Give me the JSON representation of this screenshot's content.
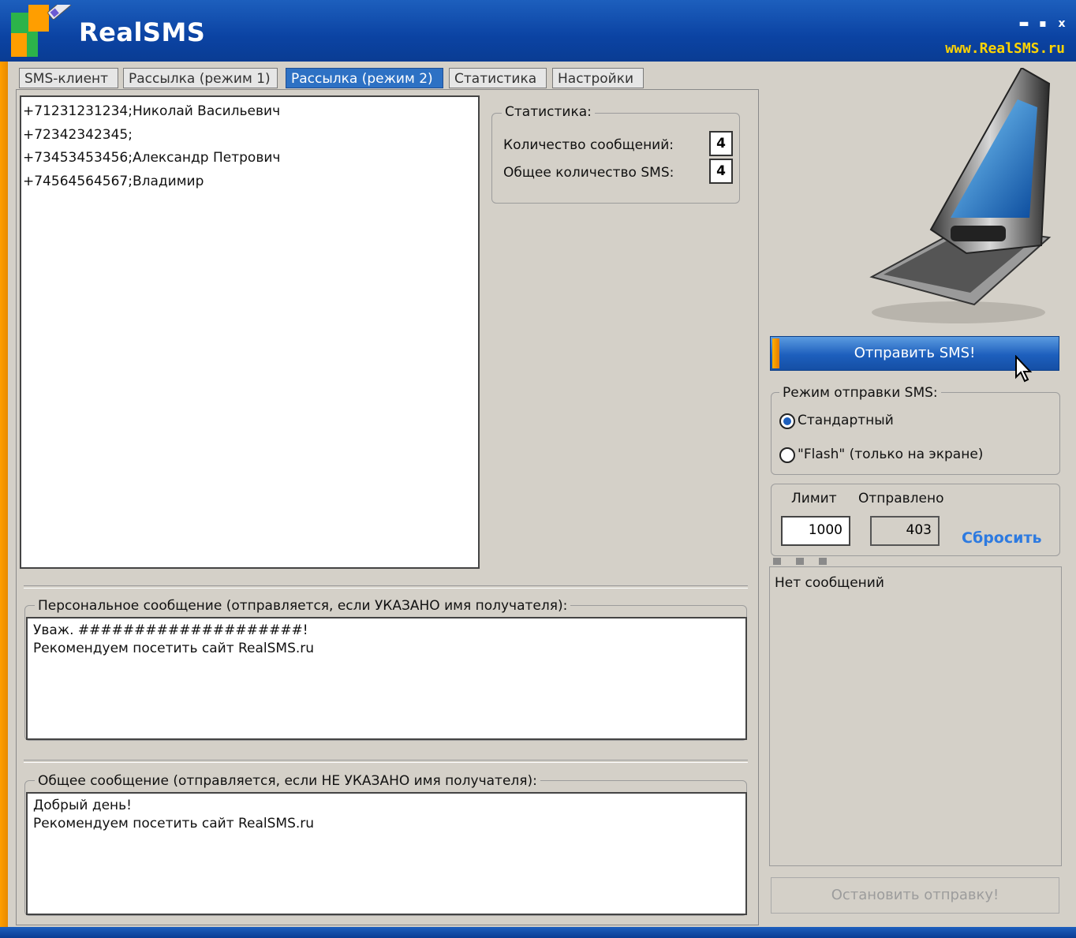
{
  "window": {
    "app_title": "RealSMS",
    "site": "www.RealSMS.ru",
    "controls": {
      "minimize": "▬",
      "maximize": "▪",
      "close": "x"
    }
  },
  "tabs": [
    {
      "label": "SMS-клиент"
    },
    {
      "label": "Рассылка (режим 1)"
    },
    {
      "label": "Рассылка (режим 2)",
      "active": true
    },
    {
      "label": "Статистика"
    },
    {
      "label": "Настройки"
    }
  ],
  "recipients": [
    "+71231231234;Николай Васильевич",
    "+72342342345;",
    "+73453453456;Александр Петрович",
    "+74564564567;Владимир"
  ],
  "stats": {
    "title": "Статистика:",
    "messages_label": "Количество сообщений:",
    "messages_value": "4",
    "sms_label": "Общее количество SMS:",
    "sms_value": "4"
  },
  "personal_message": {
    "title": "Персональное сообщение (отправляется, если УКАЗАНО имя получателя):",
    "text": "Уваж. ####################!\nРекомендуем посетить сайт RealSMS.ru"
  },
  "common_message": {
    "title": "Общее сообщение (отправляется, если НЕ УКАЗАНО имя получателя):",
    "text": "Добрый день!\nРекомендуем посетить сайт RealSMS.ru"
  },
  "send_button": "Отправить SMS!",
  "send_mode": {
    "title": "Режим отправки SMS:",
    "options": [
      {
        "label": "Стандартный",
        "selected": true
      },
      {
        "label": "\"Flash\" (только на экране)",
        "selected": false
      }
    ]
  },
  "limit": {
    "limit_label": "Лимит",
    "sent_label": "Отправлено",
    "limit_value": "1000",
    "sent_value": "403",
    "reset": "Сбросить"
  },
  "log": {
    "text": "Нет сообщений"
  },
  "stop_button": "Остановить отправку!",
  "colors": {
    "title_blue": "#1d5fbd",
    "accent_orange": "#ff9e00",
    "link_blue": "#2d7ae0",
    "site_yellow": "#ffd400"
  }
}
